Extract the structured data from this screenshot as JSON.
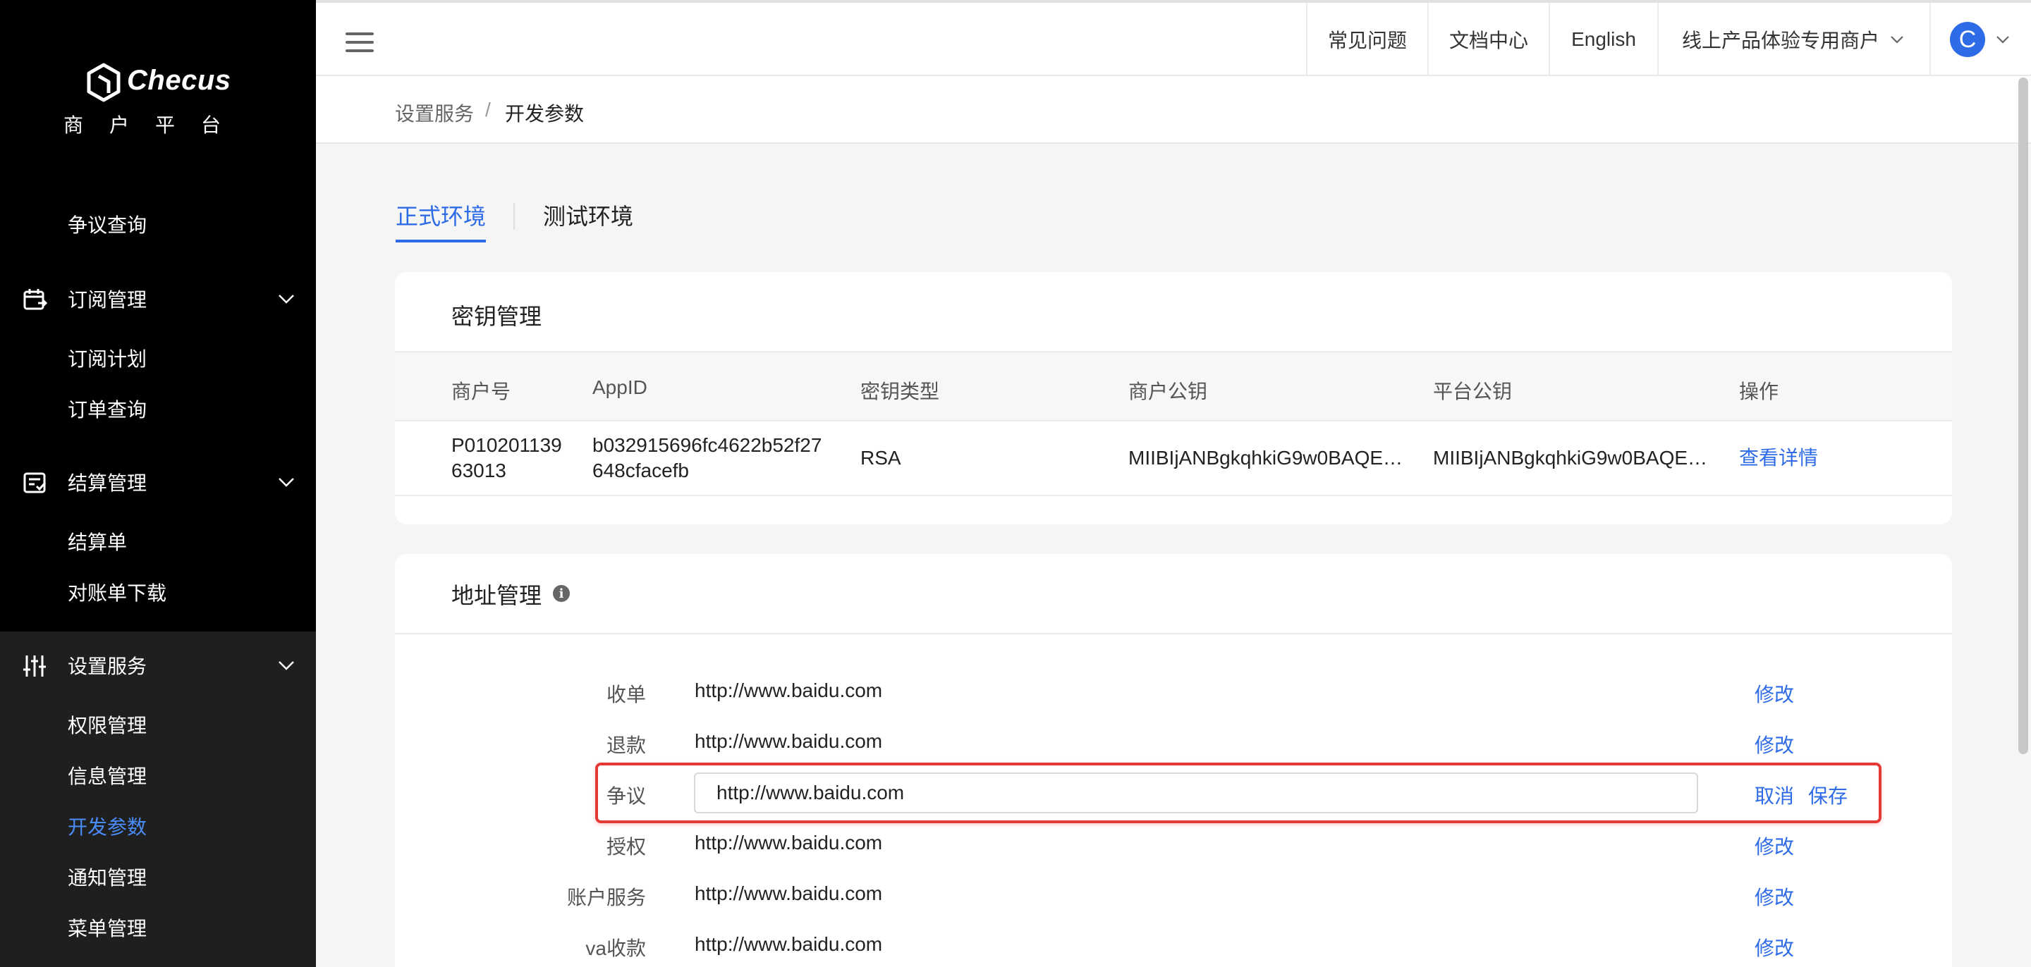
{
  "sidebar": {
    "logo_text": "Checus",
    "logo_subtitle": "商户平台",
    "items": [
      {
        "label": "争议查询"
      },
      {
        "label": "订阅管理",
        "icon": "calendar-arrow-icon"
      },
      {
        "label": "订阅计划"
      },
      {
        "label": "订单查询"
      },
      {
        "label": "结算管理",
        "icon": "checklist-icon"
      },
      {
        "label": "结算单"
      },
      {
        "label": "对账单下载"
      },
      {
        "label": "设置服务",
        "icon": "sliders-icon"
      },
      {
        "label": "权限管理"
      },
      {
        "label": "信息管理"
      },
      {
        "label": "开发参数"
      },
      {
        "label": "通知管理"
      },
      {
        "label": "菜单管理"
      }
    ],
    "active_color": "#4a8cf7"
  },
  "topbar": {
    "faq": "常见问题",
    "docs": "文档中心",
    "language": "English",
    "merchant": "线上产品体验专用商户",
    "avatar_letter": "C"
  },
  "breadcrumb": {
    "parent": "设置服务",
    "separator": "/",
    "current": "开发参数"
  },
  "tabs": [
    {
      "label": "正式环境",
      "active": true
    },
    {
      "label": "测试环境",
      "active": false
    }
  ],
  "key_management": {
    "title": "密钥管理",
    "columns": [
      "商户号",
      "AppID",
      "密钥类型",
      "商户公钥",
      "平台公钥",
      "操作"
    ],
    "row": {
      "merchant_no_line1": "P010201139",
      "merchant_no_line2": "63013",
      "appid_line1": "b032915696fc4622b52f27",
      "appid_line2": "648cfacefb",
      "key_type": "RSA",
      "merchant_pubkey": "MIIBIjANBgkqhkiG9w0BAQE…",
      "platform_pubkey": "MIIBIjANBgkqhkiG9w0BAQE…",
      "action": "查看详情"
    }
  },
  "address_management": {
    "title": "地址管理",
    "rows": [
      {
        "label": "收单",
        "value": "http://www.baidu.com",
        "action": "修改"
      },
      {
        "label": "退款",
        "value": "http://www.baidu.com",
        "action": "修改"
      },
      {
        "label": "争议",
        "value": "http://www.baidu.com",
        "cancel": "取消",
        "save": "保存",
        "editing": true
      },
      {
        "label": "授权",
        "value": "http://www.baidu.com",
        "action": "修改"
      },
      {
        "label": "账户服务",
        "value": "http://www.baidu.com",
        "action": "修改"
      },
      {
        "label": "va收款",
        "value": "http://www.baidu.com",
        "action": "修改"
      }
    ]
  },
  "colors": {
    "accent": "#2e6be6",
    "highlight": "#e53935",
    "sidebar_bg": "#000000"
  }
}
